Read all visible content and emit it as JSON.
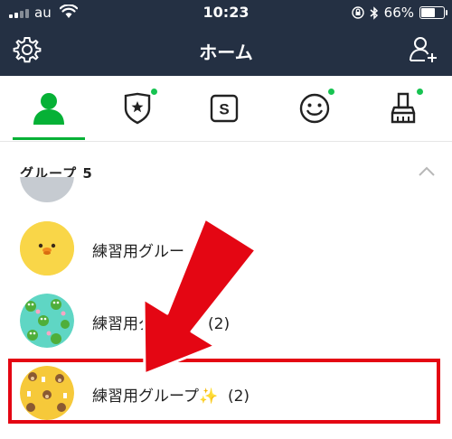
{
  "status_bar": {
    "carrier": "au",
    "time": "10:23",
    "battery": "66%",
    "battery_level": 0.66
  },
  "header": {
    "title": "ホーム",
    "left_icon": "gear-icon",
    "right_icon": "add-friend-icon"
  },
  "tabs": [
    {
      "icon": "friends-icon",
      "active": true,
      "badge": false
    },
    {
      "icon": "official-account-shield-icon",
      "active": false,
      "badge": true
    },
    {
      "icon": "sticker-shop-s-icon",
      "active": false,
      "badge": false
    },
    {
      "icon": "emoji-smile-icon",
      "active": false,
      "badge": true
    },
    {
      "icon": "theme-brush-icon",
      "active": false,
      "badge": true
    }
  ],
  "section": {
    "title": "グループ 5",
    "collapse_icon": "chevron-up-icon"
  },
  "groups": [
    {
      "label": "練習用グルー",
      "avatar": "yellow-chick-avatar"
    },
    {
      "label": "練習用グ",
      "count": "(2)",
      "avatar": "green-frog-pattern-avatar"
    },
    {
      "label": "練習用グループ✨",
      "count": "(2)",
      "avatar": "yellow-bear-pattern-avatar"
    }
  ],
  "colors": {
    "header_bg": "#243043",
    "accent_green": "#06b136",
    "badge_green": "#17c351",
    "highlight_red": "#e40613"
  }
}
